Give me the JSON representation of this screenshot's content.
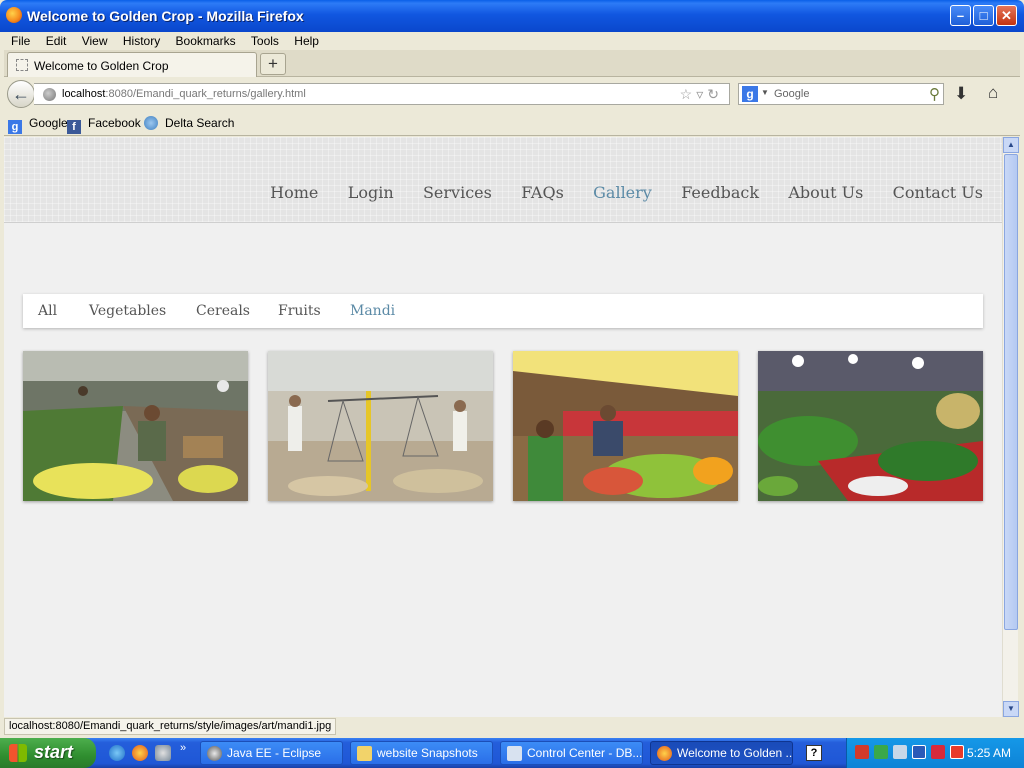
{
  "window": {
    "title": "Welcome to Golden Crop - Mozilla Firefox"
  },
  "menubar": {
    "items": [
      "File",
      "Edit",
      "View",
      "History",
      "Bookmarks",
      "Tools",
      "Help"
    ]
  },
  "tabs": [
    {
      "label": "Welcome to Golden Crop"
    }
  ],
  "newtab_label": "+",
  "address": {
    "host": "localhost",
    "rest": ":8080/Emandi_quark_returns/gallery.html"
  },
  "search": {
    "engine_glyph": "g",
    "placeholder": "Google"
  },
  "bookmarks": [
    {
      "label": "Google",
      "icon": "google-icon"
    },
    {
      "label": "Facebook",
      "icon": "facebook-icon"
    },
    {
      "label": "Delta Search",
      "icon": "delta-search-icon"
    }
  ],
  "site": {
    "nav": [
      {
        "label": "Home",
        "active": false
      },
      {
        "label": "Login",
        "active": false
      },
      {
        "label": "Services",
        "active": false
      },
      {
        "label": "FAQs",
        "active": false
      },
      {
        "label": "Gallery",
        "active": true
      },
      {
        "label": "Feedback",
        "active": false
      },
      {
        "label": "About Us",
        "active": false
      },
      {
        "label": "Contact Us",
        "active": false
      }
    ],
    "filters": [
      {
        "label": "All",
        "active": false
      },
      {
        "label": "Vegetables",
        "active": false
      },
      {
        "label": "Cereals",
        "active": false
      },
      {
        "label": "Fruits",
        "active": false
      },
      {
        "label": "Mandi",
        "active": true
      }
    ],
    "accent_color": "#5b8aa6",
    "gallery": [
      {
        "name": "vegetable-market-photo"
      },
      {
        "name": "grain-weighing-scale-photo"
      },
      {
        "name": "fruit-stall-photo"
      },
      {
        "name": "night-vegetable-market-photo"
      }
    ]
  },
  "status": {
    "text": "localhost:8080/Emandi_quark_returns/style/images/art/mandi1.jpg"
  },
  "taskbar": {
    "start_label": "start",
    "tasks": [
      {
        "label": "Java EE - Eclipse",
        "active": false
      },
      {
        "label": "website Snapshots",
        "active": false
      },
      {
        "label": "Control Center - DB...",
        "active": false
      },
      {
        "label": "Welcome to Golden ...",
        "active": true
      }
    ],
    "clock": "5:25 AM"
  }
}
